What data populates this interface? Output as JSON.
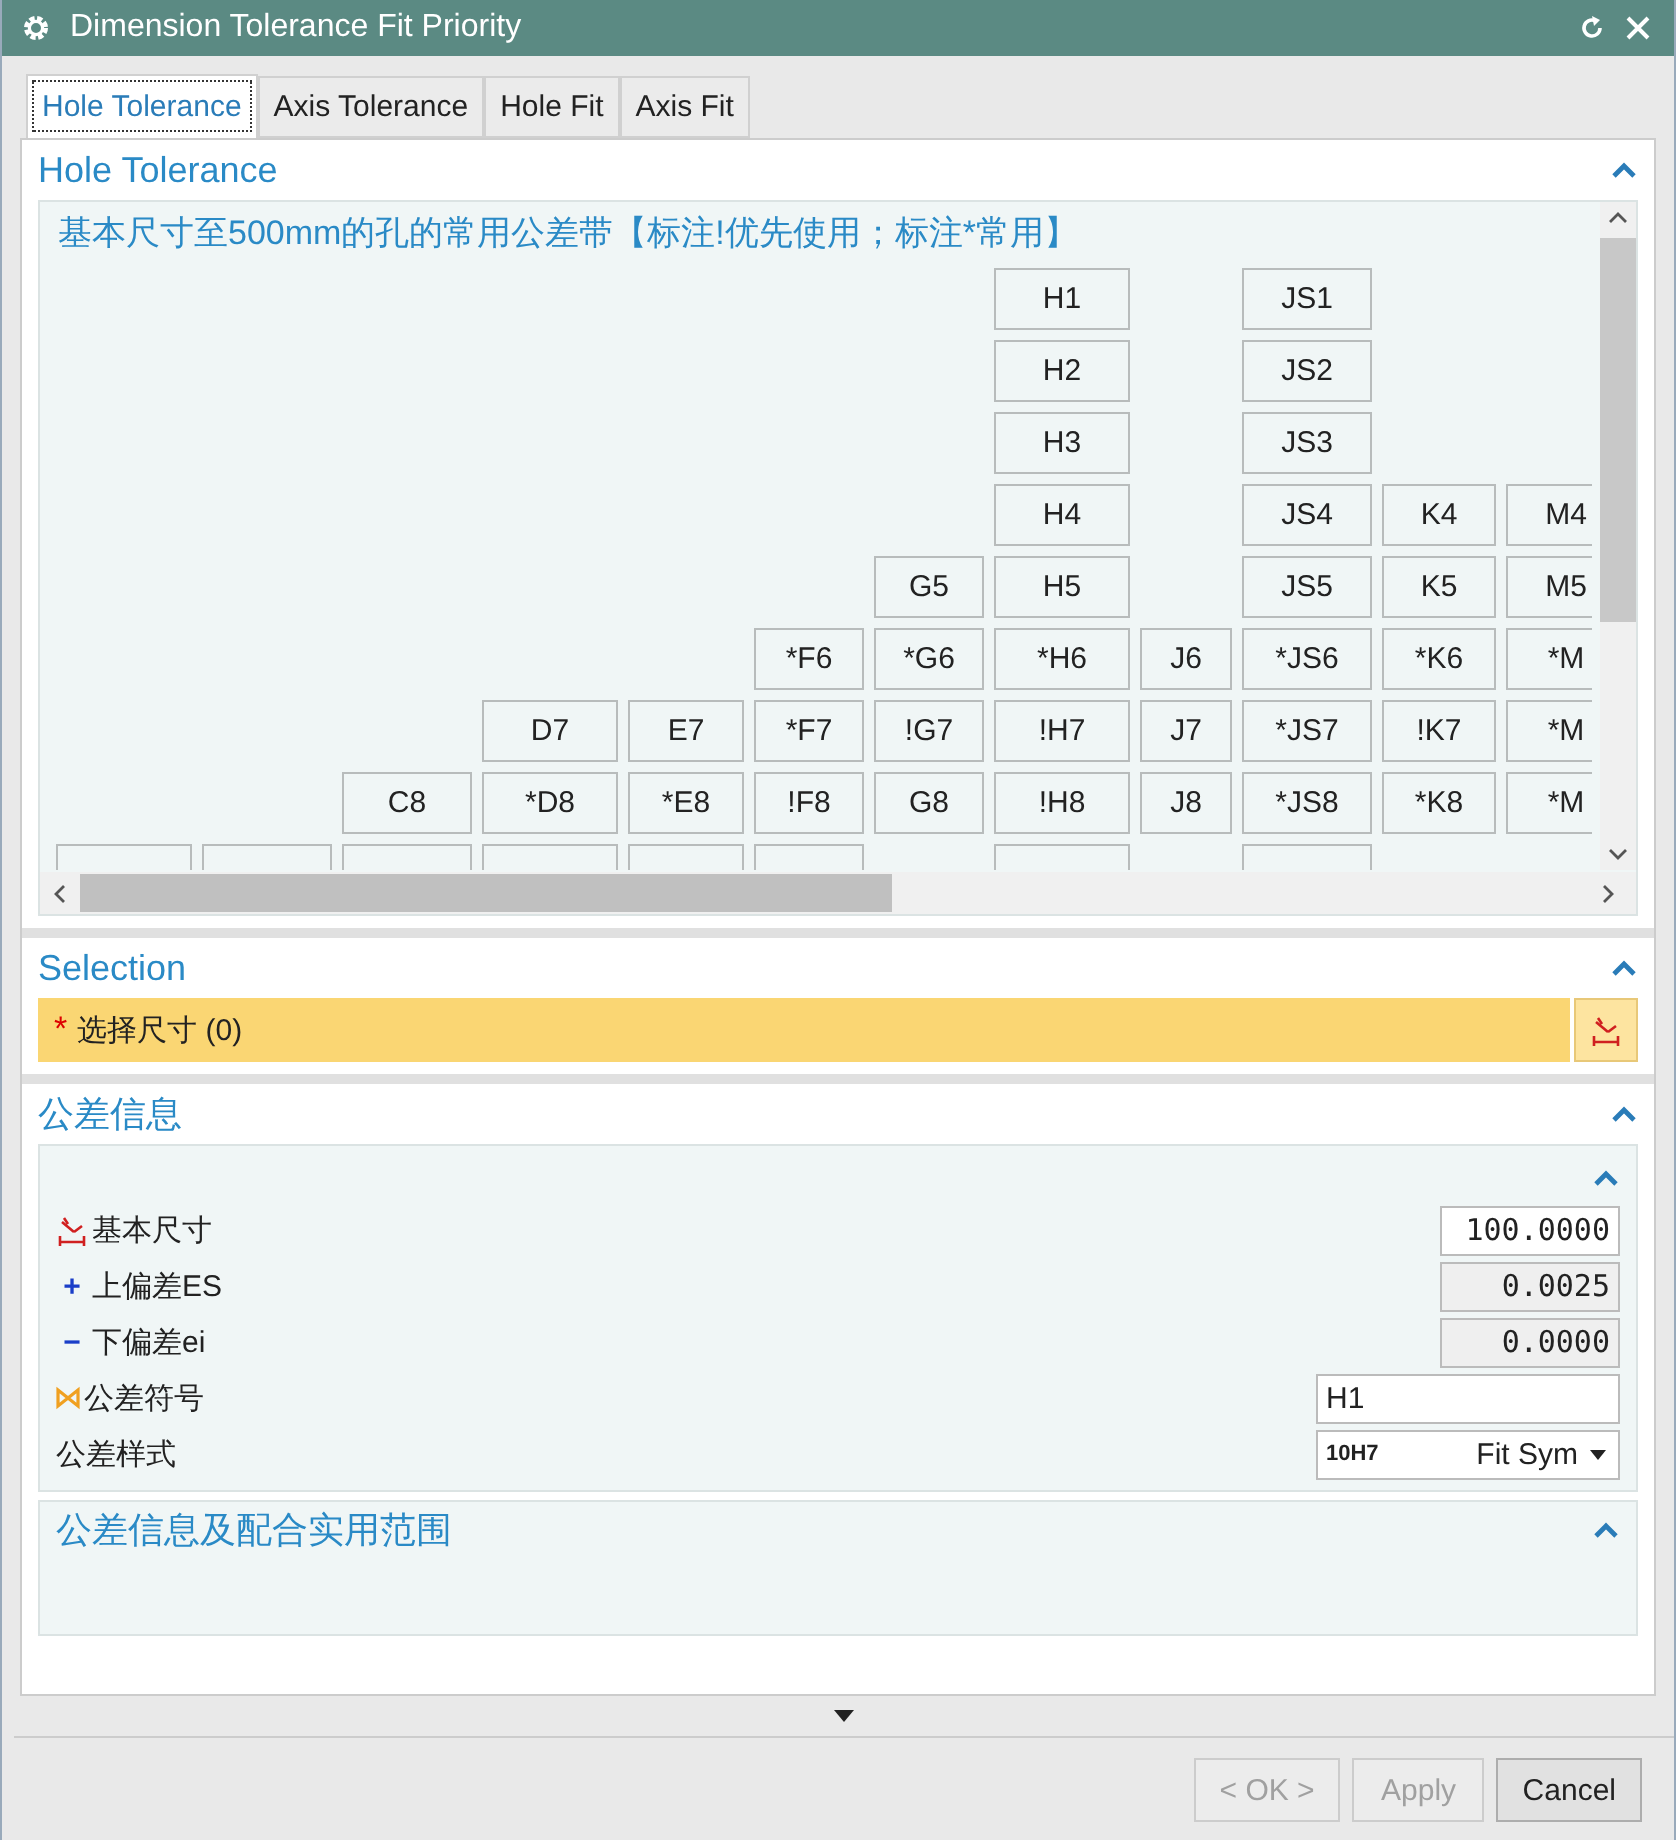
{
  "window": {
    "title": "Dimension Tolerance Fit Priority"
  },
  "tabs": [
    {
      "label": "Hole Tolerance",
      "selected": true
    },
    {
      "label": "Axis Tolerance",
      "selected": false
    },
    {
      "label": "Hole Fit",
      "selected": false
    },
    {
      "label": "Axis Fit",
      "selected": false
    }
  ],
  "hole_tolerance": {
    "title": "Hole Tolerance",
    "expanded": true,
    "caption": "基本尺寸至500mm的孔的常用公差带【标注!优先使用；标注*常用】",
    "rows": [
      [
        null,
        null,
        null,
        null,
        null,
        null,
        null,
        "H1",
        null,
        "JS1",
        null,
        null
      ],
      [
        null,
        null,
        null,
        null,
        null,
        null,
        null,
        "H2",
        null,
        "JS2",
        null,
        null
      ],
      [
        null,
        null,
        null,
        null,
        null,
        null,
        null,
        "H3",
        null,
        "JS3",
        null,
        null
      ],
      [
        null,
        null,
        null,
        null,
        null,
        null,
        null,
        "H4",
        null,
        "JS4",
        "K4",
        "M4"
      ],
      [
        null,
        null,
        null,
        null,
        null,
        null,
        "G5",
        "H5",
        null,
        "JS5",
        "K5",
        "M5"
      ],
      [
        null,
        null,
        null,
        null,
        null,
        "*F6",
        "*G6",
        "*H6",
        "J6",
        "*JS6",
        "*K6",
        "*M"
      ],
      [
        null,
        null,
        null,
        "D7",
        "E7",
        "*F7",
        "!G7",
        "!H7",
        "J7",
        "*JS7",
        "!K7",
        "*M"
      ],
      [
        null,
        null,
        "C8",
        "*D8",
        "*E8",
        "!F8",
        "G8",
        "!H8",
        "J8",
        "*JS8",
        "*K8",
        "*M"
      ]
    ],
    "clipped_row": [
      true,
      true,
      true,
      true,
      true,
      true,
      false,
      true,
      false,
      true,
      false,
      false
    ]
  },
  "selection": {
    "title": "Selection",
    "expanded": true,
    "required_mark": "*",
    "label": "选择尺寸 (0)"
  },
  "tolerance_info": {
    "title": "公差信息",
    "expanded": true,
    "inner_expanded": true,
    "fields": [
      {
        "kind": "dimension",
        "label": "基本尺寸",
        "value": "100.0000",
        "readonly": false
      },
      {
        "kind": "sign",
        "sign": "+",
        "label": "上偏差ES",
        "value": "0.0025",
        "readonly": true
      },
      {
        "kind": "sign",
        "sign": "−",
        "label": "下偏差ei",
        "value": "0.0000",
        "readonly": true
      },
      {
        "kind": "symbol",
        "label": "公差符号",
        "value": "H1",
        "readonly": false
      },
      {
        "kind": "dropdown",
        "label": "公差样式",
        "prefix": "10H7",
        "value": "Fit Sym"
      }
    ],
    "subsection": {
      "title": "公差信息及配合实用范围",
      "expanded": true
    }
  },
  "buttons": [
    {
      "label": "< OK >",
      "disabled": true
    },
    {
      "label": "Apply",
      "disabled": true
    },
    {
      "label": "Cancel",
      "disabled": false
    }
  ]
}
